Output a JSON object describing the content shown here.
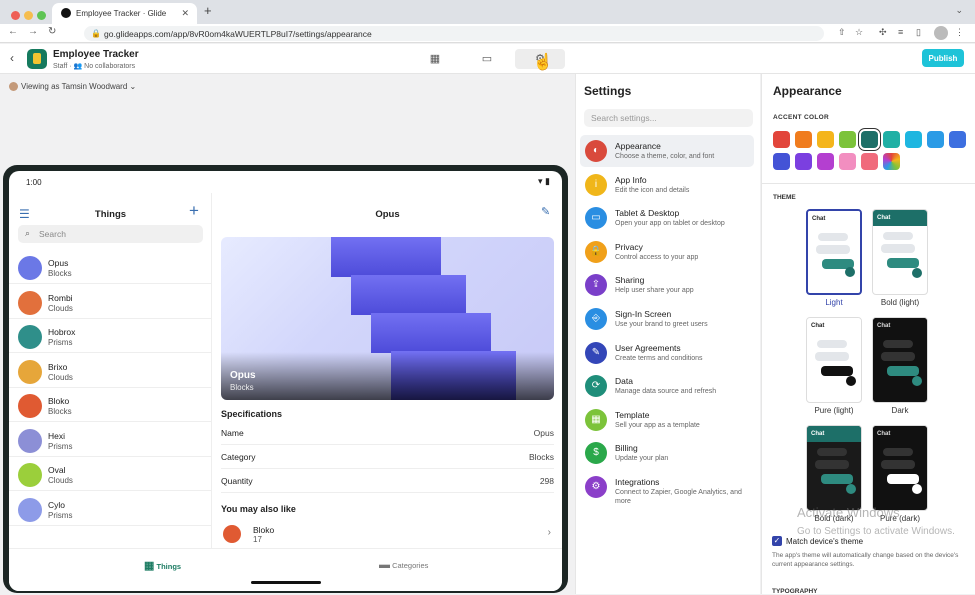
{
  "browser": {
    "tab_title": "Employee Tracker · Glide",
    "new_tab": "+",
    "url": "go.glideapps.com/app/8vR0om4kaWUERTLP8uI7/settings/appearance"
  },
  "app": {
    "name": "Employee Tracker",
    "subtitle": "Staff · 👥 No collaborators",
    "publish": "Publish",
    "viewing_as": "Viewing as Tamsin Woodward"
  },
  "device": {
    "time": "1:00",
    "status_icons": "▾ ▮",
    "list_title": "Things",
    "search_placeholder": "Search",
    "items": [
      {
        "name": "Opus",
        "category": "Blocks",
        "color": "#6b78e6"
      },
      {
        "name": "Rombi",
        "category": "Clouds",
        "color": "#e2703c"
      },
      {
        "name": "Hobrox",
        "category": "Prisms",
        "color": "#2f8f8a"
      },
      {
        "name": "Brixo",
        "category": "Clouds",
        "color": "#e6a63a"
      },
      {
        "name": "Bloko",
        "category": "Blocks",
        "color": "#e05a32"
      },
      {
        "name": "Hexi",
        "category": "Prisms",
        "color": "#8c8fd6"
      },
      {
        "name": "Oval",
        "category": "Clouds",
        "color": "#9bcf3b"
      },
      {
        "name": "Cylo",
        "category": "Prisms",
        "color": "#8d9be8"
      }
    ],
    "detail_title": "Opus",
    "hero_name": "Opus",
    "hero_category": "Blocks",
    "specs_heading": "Specifications",
    "specs": [
      {
        "key": "Name",
        "value": "Opus"
      },
      {
        "key": "Category",
        "value": "Blocks"
      },
      {
        "key": "Quantity",
        "value": "298"
      }
    ],
    "also_heading": "You may also like",
    "also_name": "Bloko",
    "also_number": "17",
    "nav_things": "Things",
    "nav_categories": "Categories"
  },
  "settings": {
    "title": "Settings",
    "search_placeholder": "Search settings...",
    "items": [
      {
        "name": "Appearance",
        "desc": "Choose a theme, color, and font",
        "color": "#d94a3c",
        "icon": "◐"
      },
      {
        "name": "App Info",
        "desc": "Edit the icon and details",
        "color": "#f0b61a",
        "icon": "i"
      },
      {
        "name": "Tablet & Desktop",
        "desc": "Open your app on tablet or desktop",
        "color": "#2a8ee2",
        "icon": "▭"
      },
      {
        "name": "Privacy",
        "desc": "Control access to your app",
        "color": "#f0a01a",
        "icon": "🔒"
      },
      {
        "name": "Sharing",
        "desc": "Help user share your app",
        "color": "#7a3fc9",
        "icon": "⇪"
      },
      {
        "name": "Sign-In Screen",
        "desc": "Use your brand to greet users",
        "color": "#2a8ee2",
        "icon": "⎆"
      },
      {
        "name": "User Agreements",
        "desc": "Create terms and conditions",
        "color": "#3346b8",
        "icon": "✎"
      },
      {
        "name": "Data",
        "desc": "Manage data source and refresh",
        "color": "#1f8e7a",
        "icon": "⟳"
      },
      {
        "name": "Template",
        "desc": "Sell your app as a template",
        "color": "#7cc33a",
        "icon": "▦"
      },
      {
        "name": "Billing",
        "desc": "Update your plan",
        "color": "#2aa84a",
        "icon": "$"
      },
      {
        "name": "Integrations",
        "desc": "Connect to Zapier, Google Analytics, and more",
        "color": "#8b3fc9",
        "icon": "⚙"
      }
    ]
  },
  "appearance": {
    "title": "Appearance",
    "accent_label": "ACCENT COLOR",
    "accent_colors": [
      "#e2453b",
      "#f07c1e",
      "#f4b51b",
      "#7cc33a",
      "#1d6f68",
      "#1fb0a5",
      "#1eb6e0",
      "#2b9be6",
      "#3d6fe0",
      "#4453d6",
      "#7b3fe0",
      "#b43fd0",
      "#f28ec0",
      "#f06b7c",
      "#e4445e"
    ],
    "theme_label": "THEME",
    "themes": [
      {
        "label": "Light",
        "chat": "Chat"
      },
      {
        "label": "Bold (light)",
        "chat": "Chat"
      },
      {
        "label": "Pure (light)",
        "chat": "Chat"
      },
      {
        "label": "Dark",
        "chat": "Chat"
      },
      {
        "label": "Bold (dark)",
        "chat": "Chat"
      },
      {
        "label": "Pure (dark)",
        "chat": "Chat"
      }
    ],
    "match_label": "Match device's theme",
    "match_note": "The app's theme will automatically change based on the device's current appearance settings.",
    "typography": "TYPOGRAPHY"
  },
  "watermark": {
    "line1": "Activate Windows",
    "line2": "Go to Settings to activate Windows."
  }
}
